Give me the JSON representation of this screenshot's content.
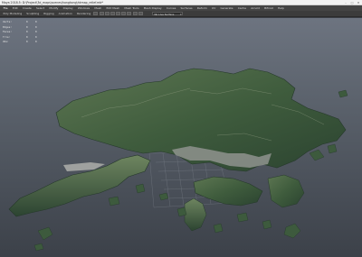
{
  "window": {
    "title": "Maya 2018.5: D:\\Project\\3d_maps\\scenes\\hongkong\\hkmap_relief.mb*",
    "controls": [
      "–",
      "□",
      "✕"
    ]
  },
  "menu": {
    "items": [
      "File",
      "Edit",
      "Create",
      "Select",
      "Modify",
      "Display",
      "Windows",
      "Mesh",
      "Edit Mesh",
      "Mesh Tools",
      "Mesh Display",
      "Curves",
      "Surfaces",
      "Deform",
      "UV",
      "Generate",
      "Cache",
      "Arnold",
      "Bifrost",
      "Help"
    ]
  },
  "shelf": {
    "tabs": [
      "Poly Modeling",
      "Sculpting",
      "Rigging",
      "Animation",
      "Rendering"
    ],
    "workspace_value": "No Live Surface"
  },
  "hud": {
    "rows": [
      {
        "label": "Verts:",
        "v1": "0",
        "v2": "0"
      },
      {
        "label": "Edges:",
        "v1": "0",
        "v2": "0"
      },
      {
        "label": "Faces:",
        "v1": "0",
        "v2": "0"
      },
      {
        "label": "Tris:",
        "v1": "0",
        "v2": "0"
      },
      {
        "label": "UVs:",
        "v1": "0",
        "v2": "0"
      }
    ]
  },
  "colors": {
    "terrain_dark": "#2f4a33",
    "terrain_mid": "#4d6b45",
    "terrain_light": "#7d8c6a",
    "urban": "#9a9c98",
    "viewport_top": "#6d7480",
    "viewport_bottom": "#3c4149",
    "grid": "#8a909a"
  }
}
